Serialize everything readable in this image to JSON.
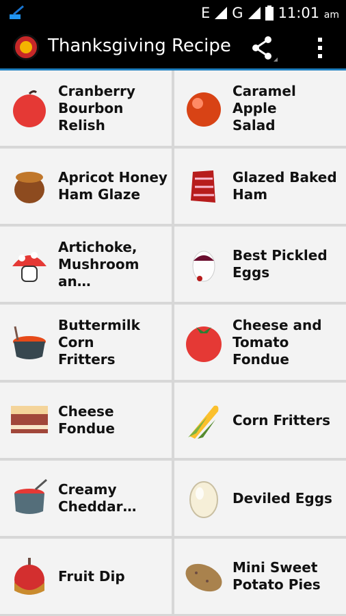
{
  "status_bar": {
    "time": "11:01",
    "am_pm": "am",
    "network": "E"
  },
  "app_bar": {
    "title": "Thanksgiving Recipe",
    "share_icon": "share-icon",
    "overflow_icon": "more-vert-icon"
  },
  "recipes": [
    {
      "label": "Cranberry\nBourbon Relish",
      "icon": "apple-icon"
    },
    {
      "label": "Caramel Apple\nSalad",
      "icon": "tomato-icon"
    },
    {
      "label": "Apricot Honey\nHam Glaze",
      "icon": "honey-pot-icon"
    },
    {
      "label": "Glazed Baked\nHam",
      "icon": "ham-icon"
    },
    {
      "label": "Artichoke,\nMushroom an…",
      "icon": "mushroom-icon"
    },
    {
      "label": "Best Pickled\nEggs",
      "icon": "egg-icon"
    },
    {
      "label": "Buttermilk Corn\nFritters",
      "icon": "cooking-pot-icon"
    },
    {
      "label": "Cheese and\nTomato Fondue",
      "icon": "tomato-icon"
    },
    {
      "label": "Cheese Fondue",
      "icon": "cake-icon"
    },
    {
      "label": "Corn Fritters",
      "icon": "corn-icon"
    },
    {
      "label": "Creamy\nCheddar…",
      "icon": "pot-icon"
    },
    {
      "label": "Deviled Eggs",
      "icon": "egg-icon"
    },
    {
      "label": "Fruit Dip",
      "icon": "candy-apple-icon"
    },
    {
      "label": "Mini Sweet\nPotato Pies",
      "icon": "potato-icon"
    }
  ]
}
